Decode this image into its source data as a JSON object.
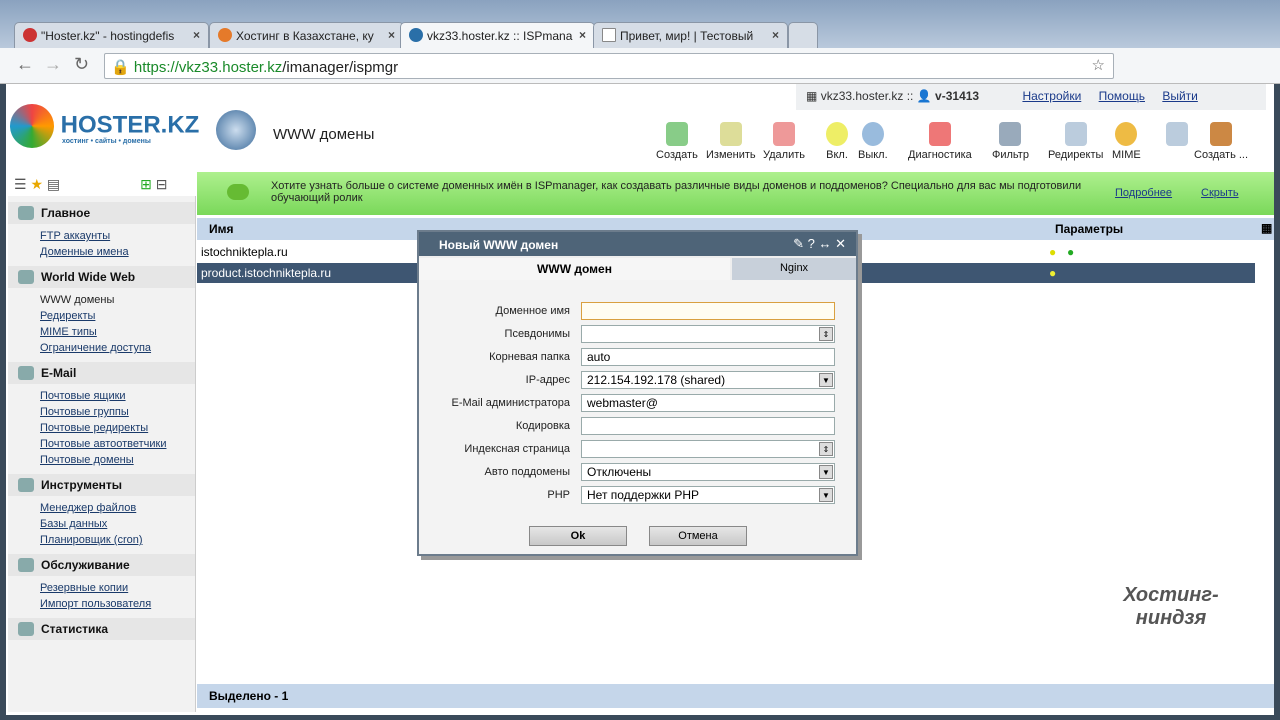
{
  "browser": {
    "tabs": [
      {
        "label": "\"Hoster.kz\" - hostingdefis"
      },
      {
        "label": "Хостинг в Казахстане, ку"
      },
      {
        "label": "vkz33.hoster.kz :: ISPmana"
      },
      {
        "label": "Привет, мир! | Тестовый"
      }
    ],
    "url_host": "https://vkz33.hoster.kz",
    "url_path": "/imanager/ispmgr"
  },
  "logo": {
    "text": "HOSTER.KZ",
    "tagline": "хостинг • сайты • домены"
  },
  "page_title": "WWW домены",
  "userbar": {
    "server": "vkz33.hoster.kz ::",
    "user": "v-31413",
    "settings": "Настройки",
    "help": "Помощь",
    "logout": "Выйти"
  },
  "toolbar": [
    "Создать",
    "Изменить",
    "Удалить",
    "Вкл.",
    "Выкл.",
    "Диагностика",
    "Фильтр",
    "Редиректы",
    "MIME",
    "Создать ..."
  ],
  "sidebar": [
    {
      "title": "Главное",
      "items": [
        "FTP аккаунты",
        "Доменные имена"
      ]
    },
    {
      "title": "World Wide Web",
      "items": [
        "WWW домены",
        "Редиректы",
        "MIME типы",
        "Ограничение доступа"
      ]
    },
    {
      "title": "E-Mail",
      "items": [
        "Почтовые ящики",
        "Почтовые группы",
        "Почтовые редиректы",
        "Почтовые автоответчики",
        "Почтовые домены"
      ]
    },
    {
      "title": "Инструменты",
      "items": [
        "Менеджер файлов",
        "Базы данных",
        "Планировщик (cron)"
      ]
    },
    {
      "title": "Обслуживание",
      "items": [
        "Резервные копии",
        "Импорт пользователя"
      ]
    },
    {
      "title": "Статистика",
      "items": []
    }
  ],
  "banner": {
    "text": "Хотите узнать больше о системе доменных имён в ISPmanager, как создавать различные виды доменов и поддоменов? Специально для вас мы подготовили обучающий ролик",
    "more": "Подробнее",
    "hide": "Скрыть"
  },
  "table": {
    "col_name": "Имя",
    "col_params": "Параметры",
    "rows": [
      "istochniktepla.ru",
      "product.istochniktepla.ru"
    ]
  },
  "footer": "Выделено - 1",
  "dialog": {
    "title": "Новый WWW домен",
    "tab1": "WWW домен",
    "tab2": "Nginx",
    "fields": [
      {
        "label": "Доменное имя",
        "value": ""
      },
      {
        "label": "Псевдонимы",
        "value": ""
      },
      {
        "label": "Корневая папка",
        "value": "auto"
      },
      {
        "label": "IP-адрес",
        "value": "212.154.192.178 (shared)"
      },
      {
        "label": "E-Mail администратора",
        "value": "webmaster@"
      },
      {
        "label": "Кодировка",
        "value": ""
      },
      {
        "label": "Индексная страница",
        "value": ""
      },
      {
        "label": "Авто поддомены",
        "value": "Отключены"
      },
      {
        "label": "PHP",
        "value": "Нет поддержки PHP"
      }
    ],
    "ok": "Ok",
    "cancel": "Отмена"
  }
}
